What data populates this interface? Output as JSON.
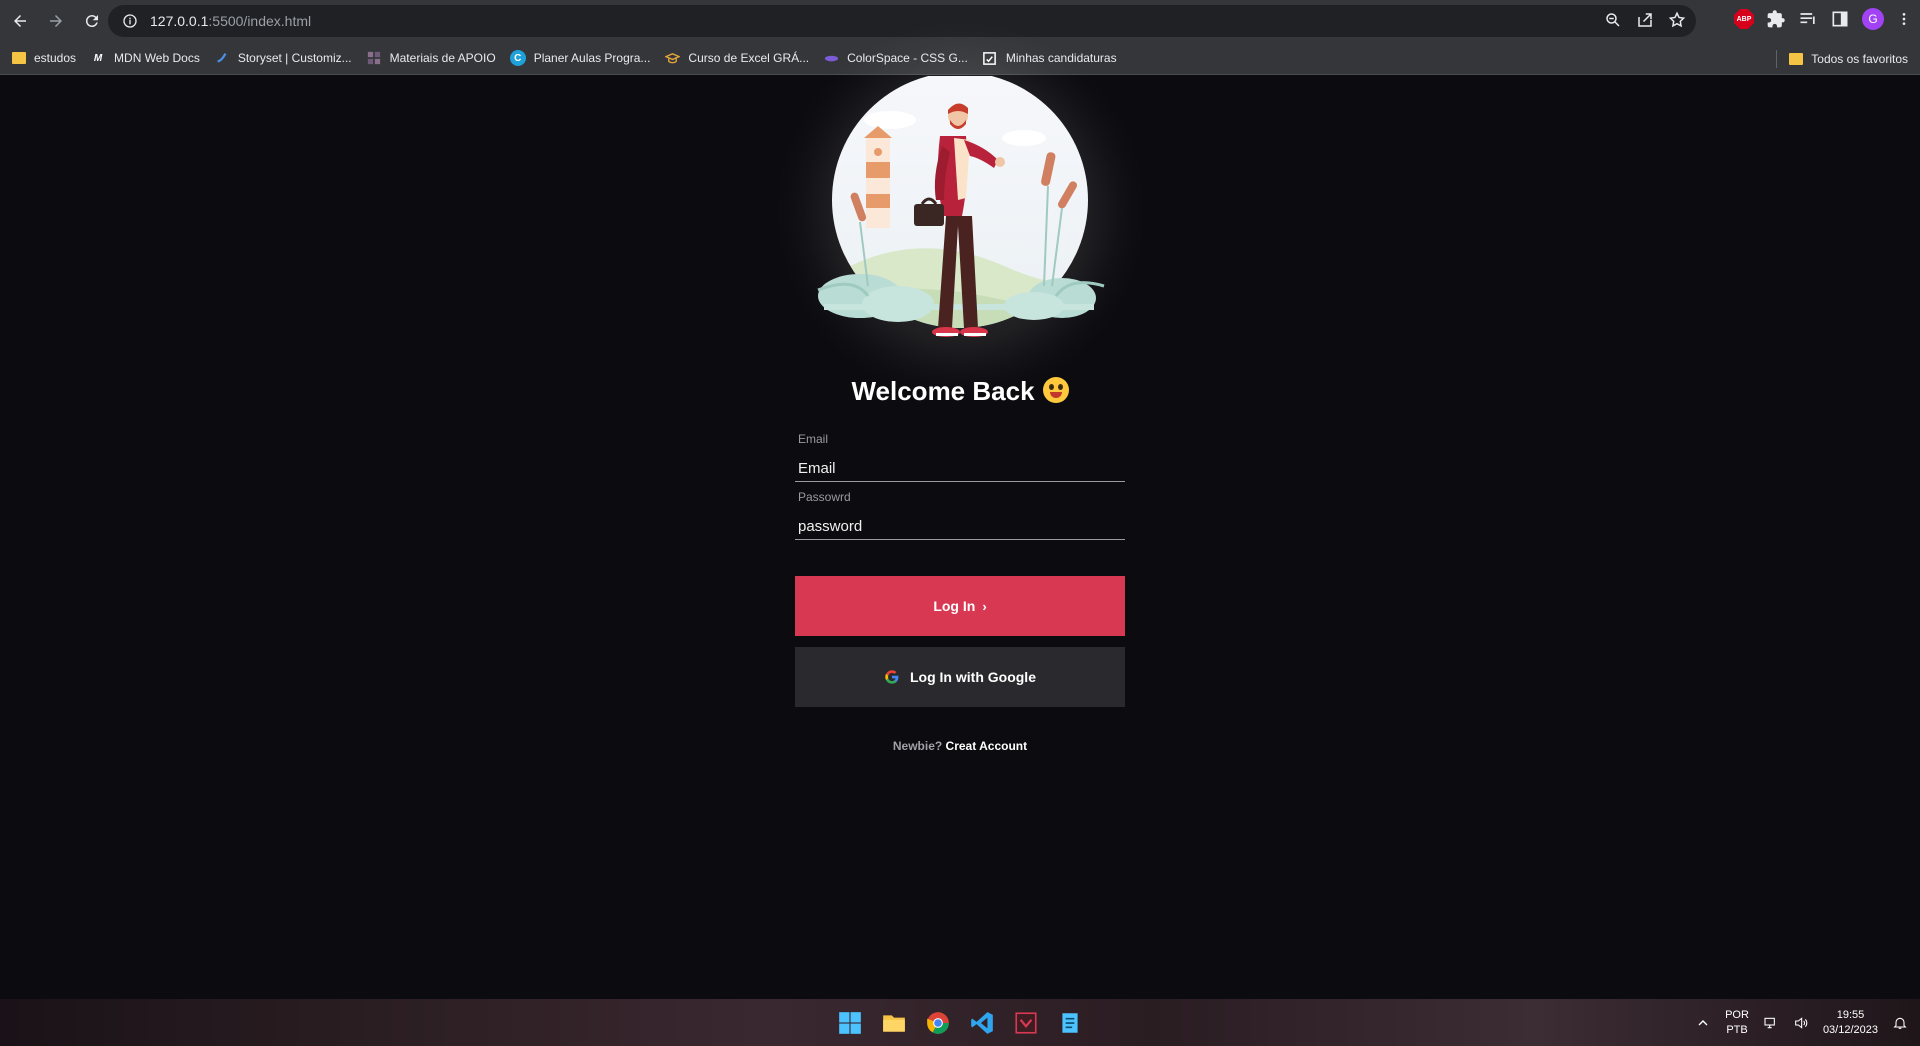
{
  "browser": {
    "url_host": "127.0.0.1",
    "url_rest": ":5500/index.html",
    "bookmarks": [
      {
        "label": "estudos",
        "icon": "folder-icon"
      },
      {
        "label": "MDN Web Docs",
        "icon": "mdn-icon"
      },
      {
        "label": "Storyset | Customiz...",
        "icon": "storyset-icon"
      },
      {
        "label": "Materiais de APOIO",
        "icon": "grid-icon"
      },
      {
        "label": "Planer Aulas Progra...",
        "icon": "canva-icon"
      },
      {
        "label": "Curso de Excel GRÁ...",
        "icon": "graduation-cap-icon"
      },
      {
        "label": "ColorSpace - CSS G...",
        "icon": "colorspace-icon"
      },
      {
        "label": "Minhas candidaturas",
        "icon": "document-icon"
      }
    ],
    "all_bookmarks": "Todos os favoritos",
    "profile_initial": "G",
    "abp_label": "ABP"
  },
  "page": {
    "title": "Welcome Back",
    "email": {
      "label": "Email",
      "placeholder": "Email"
    },
    "password": {
      "label": "Passowrd",
      "placeholder": "password"
    },
    "login_button": "Log In",
    "google_button": "Log In with Google",
    "signup_prompt": "Newbie?",
    "signup_link": "Creat Account",
    "accent_color": "#d93853"
  },
  "taskbar": {
    "lang_top": "POR",
    "lang_bottom": "PTB",
    "time": "19:55",
    "date": "03/12/2023"
  }
}
